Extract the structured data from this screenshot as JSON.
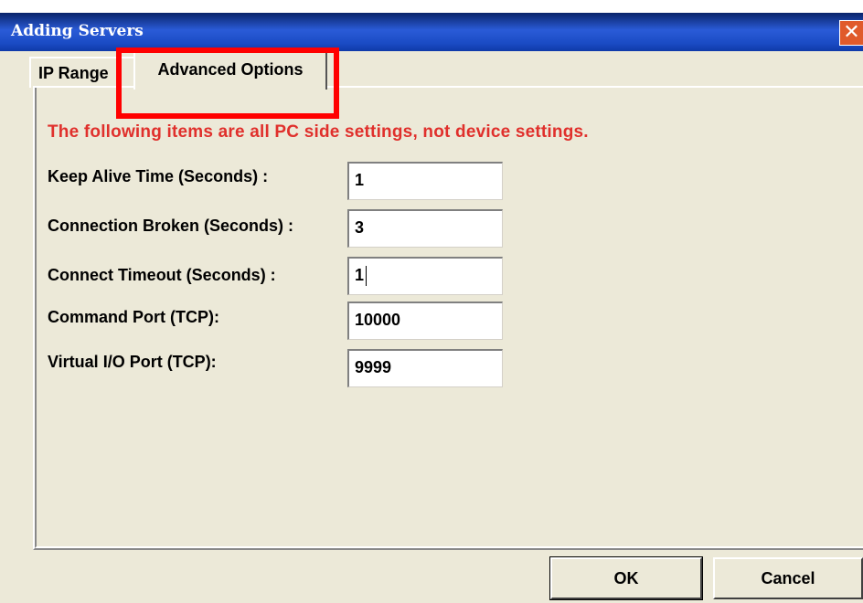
{
  "window": {
    "title": "Adding Servers",
    "close_glyph": "✕"
  },
  "tabs": [
    {
      "label": "IP Range",
      "selected": false
    },
    {
      "label": "Advanced Options",
      "selected": true
    }
  ],
  "notice": "The following items are all PC side settings, not device settings.",
  "fields": [
    {
      "label": "Keep Alive Time (Seconds) :",
      "value": "1"
    },
    {
      "label": "Connection Broken (Seconds) :",
      "value": "3"
    },
    {
      "label": "Connect Timeout (Seconds) :",
      "value": "1"
    },
    {
      "label": "Command Port (TCP):",
      "value": "10000"
    },
    {
      "label": "Virtual I/O Port (TCP):",
      "value": "9999"
    }
  ],
  "buttons": {
    "ok": "OK",
    "cancel": "Cancel"
  },
  "colors": {
    "notice": "#e0302c",
    "highlight": "#ff0000",
    "titlebar": "#1a4bc4"
  }
}
